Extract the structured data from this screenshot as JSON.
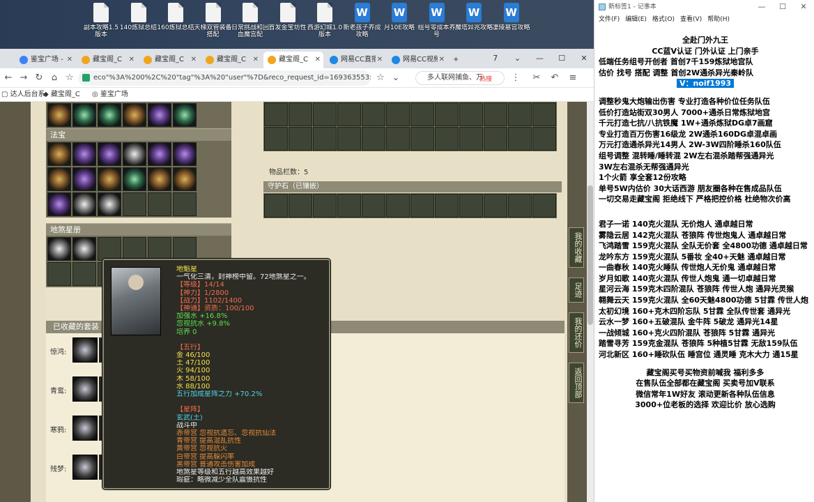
{
  "desktop": {
    "icons": [
      {
        "label": "副本攻略1.5版本",
        "type": "doc"
      },
      {
        "label": "140炼狱总结",
        "type": "doc"
      },
      {
        "label": "160炼狱总结",
        "type": "doc"
      },
      {
        "label": "天梯双管装备搭配",
        "type": "doc"
      },
      {
        "label": "日常挑战和回血魔宫配",
        "type": "doc"
      },
      {
        "label": "首发金宝坊性",
        "type": "doc"
      },
      {
        "label": "西游幻城1.0版本",
        "type": "doc"
      },
      {
        "label": "新老孩子养成攻略",
        "type": "word"
      },
      {
        "label": "月10E攻略",
        "type": "word"
      },
      {
        "label": "组号零成本养号",
        "type": "word"
      },
      {
        "label": "魔塔异兆攻略",
        "type": "word"
      },
      {
        "label": "凄陵墓宫攻略",
        "type": "word"
      }
    ]
  },
  "browser": {
    "tabs": [
      {
        "label": "鉴宝广场 -"
      },
      {
        "label": "藏宝阁_C"
      },
      {
        "label": "藏宝阁_C"
      },
      {
        "label": "藏宝阁_C"
      },
      {
        "label": "藏宝阁_C",
        "active": true
      },
      {
        "label": "网易CC直播"
      },
      {
        "label": "网易CC视频"
      }
    ],
    "new_tab": "+",
    "tab_badge": "7",
    "address": "eco\"%3A%200%2C%20\"tag\"%3A%20\"user\"%7D&reco_request_id=1693635535145xlf_i",
    "search_text": "多人联网捕鱼、万",
    "search_hot": "热搜",
    "bookmarks": [
      "达人后台系",
      "藏宝阁_C",
      "鉴宝广场"
    ]
  },
  "game": {
    "section_fabao": "法宝",
    "section_stars": "地煞星册",
    "item_count": "物品栏数：5",
    "guard_title": "守护石（已镶嵌）",
    "suits_title": "已收藏的套装",
    "suits": [
      {
        "name": "惊鸿:"
      },
      {
        "name": "青鸾:"
      },
      {
        "name": "寒鸦:"
      },
      {
        "name": "残梦:"
      }
    ],
    "side_tabs": [
      "我的收藏",
      "足迹",
      "我的还价",
      "返回顶部"
    ],
    "tooltip": {
      "lines": [
        {
          "text": "地魁星",
          "color": "yellow"
        },
        {
          "text": "一气化三清，封神榜中留。72地煞星之一。",
          "color": "white"
        },
        {
          "text": "【等级】14/14",
          "color": "red"
        },
        {
          "text": "【神力】1/2800",
          "color": "red"
        },
        {
          "text": "【战力】1102/1400",
          "color": "red"
        },
        {
          "text": "【神通】资质：100/100",
          "color": "red"
        },
        {
          "text": "加强水 +16.8%",
          "color": "green"
        },
        {
          "text": "忽视抗水 +9.8%",
          "color": "green"
        },
        {
          "text": "培养 0",
          "color": "green"
        },
        {
          "text": "",
          "color": "white"
        },
        {
          "text": "【五行】",
          "color": "red"
        },
        {
          "text": "金 46/100",
          "color": "yellow"
        },
        {
          "text": "土 47/100",
          "color": "yellow"
        },
        {
          "text": "火 94/100",
          "color": "yellow"
        },
        {
          "text": "木 58/100",
          "color": "yellow"
        },
        {
          "text": "水 88/100",
          "color": "yellow"
        },
        {
          "text": "五行加成星阵之力 +70.2%",
          "color": "cyan"
        },
        {
          "text": "",
          "color": "white"
        },
        {
          "text": "【星阵】",
          "color": "red"
        },
        {
          "text": "玄武(土)",
          "color": "cyan"
        },
        {
          "text": "战斗中",
          "color": "white"
        },
        {
          "text": "赤帝宫 忽视抗遗忘、忽视抗仙法",
          "color": "orange"
        },
        {
          "text": "青帝宫 提高混乱抗性",
          "color": "orange"
        },
        {
          "text": "黄帝宫 忽视抗火",
          "color": "orange"
        },
        {
          "text": "白帝宫 提高躲闪率",
          "color": "orange"
        },
        {
          "text": "黑帝宫 普通攻击伤害加成",
          "color": "orange"
        },
        {
          "text": "地煞星等级和五行越高效果越好",
          "color": "white"
        },
        {
          "text": "瑕疵：略微减少全队震慑抗性",
          "color": "white"
        }
      ]
    }
  },
  "notepad": {
    "title": "新标签1 - 记事本",
    "menu": [
      "文件(F)",
      "编辑(E)",
      "格式(O)",
      "查看(V)",
      "帮助(H)"
    ],
    "lines": [
      {
        "text": "全赴门外九王",
        "align": "center"
      },
      {
        "text": "CC蓝V认证  门外认证  上门亲手",
        "align": "center"
      },
      {
        "text": "低端任务组号开创者          首创7千159炼狱地宫队",
        "align": "left"
      },
      {
        "text": "估价 找号 搭配 调整          首创2W通杀异光秦岭队",
        "align": "left"
      },
      {
        "text": "V：noif1993",
        "align": "center",
        "highlight": true
      },
      {
        "text": "",
        "align": "gap"
      },
      {
        "text": "调整秒鬼大炮输出伤害          专业打造各种价位任务队伍",
        "align": "left"
      },
      {
        "text": "低价打造站街双30男人          7000+通杀日常炼狱地宫",
        "align": "left"
      },
      {
        "text": "千元打造七抗/八抗铁魔          1W+通杀炼狱DG卓7画窟",
        "align": "left"
      },
      {
        "text": "专业打造百万伤害16级龙          2W通杀160DG卓混卓画",
        "align": "left"
      },
      {
        "text": "万元打造通杀异光14男人        2W-3W四阶睡杀160队伍",
        "align": "left"
      },
      {
        "text": "组号调整 混转睡/睡转混          2W左右混杀踏帮强通异光",
        "align": "left"
      },
      {
        "text": "                                  3W左右混杀无帮强通异光",
        "align": "left"
      },
      {
        "text": "1个火箭 享全套12份攻略",
        "align": "left"
      },
      {
        "text": "单号5W内估价 30大话西游        朋友圈各种在售成品队伍",
        "align": "left"
      },
      {
        "text": "一切交易走藏宝阁 拒绝线下     严格把控价格 杜绝物次价高",
        "align": "left"
      },
      {
        "text": "",
        "align": "gap"
      },
      {
        "text": "",
        "align": "gap"
      },
      {
        "text": "君子一诺 140克火混队 无价炮人 通卓越日常",
        "align": "left"
      },
      {
        "text": "雾隐云居 142克火混队 苍狼阵 传世炮鬼人 通卓越日常",
        "align": "left"
      },
      {
        "text": "飞鸿踏雪 159克火混队 全队无价套 全4800功德 通卓越日常",
        "align": "left"
      },
      {
        "text": "龙吟东方 159克火混队 5番妆 全40+天魅 通卓越日常",
        "align": "left"
      },
      {
        "text": "一曲春秋 140克火睡队 传世炮人无价鬼 通卓越日常",
        "align": "left"
      },
      {
        "text": "岁月如歌 140克火混队 传世人炮鬼 通一切卓越日常",
        "align": "left"
      },
      {
        "text": "星河云海 159克木四阶混队 苍狼阵 传世人炮 通异光灵猴",
        "align": "left"
      },
      {
        "text": "翱舞云天 159克火混队 全60天魅4800功德 5甘霖 传世人炮",
        "align": "left"
      },
      {
        "text": "太初幻境 160+克木四阶忘队 5甘霖 全队传世套 通异光",
        "align": "left"
      },
      {
        "text": "云水一梦 160+五破混队 金牛阵 5破龙 通异光14星",
        "align": "left"
      },
      {
        "text": "一战倾城 160+克火四阶混队 苍狼阵 5甘霖 通异光",
        "align": "left"
      },
      {
        "text": "踏雪寻芳 159克金混队 苍狼阵 5种植5甘霖 无敌159队伍",
        "align": "left"
      },
      {
        "text": "河北新区 160+睡砍队伍 睡宫位 通灵睡 克木大力 通15星",
        "align": "left"
      },
      {
        "text": "",
        "align": "gap"
      },
      {
        "text": "藏宝阁买号买物资前喊我 福利多多",
        "align": "center"
      },
      {
        "text": "在售队伍全部都在藏宝阁 买卖号加V联系",
        "align": "center"
      },
      {
        "text": "微信常年1W好友 滚动更新各种队伍信息",
        "align": "center"
      },
      {
        "text": "3000+位老板的选择 欢迎比价 放心选购",
        "align": "center"
      }
    ]
  }
}
